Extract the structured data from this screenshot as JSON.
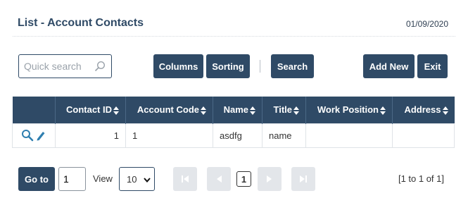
{
  "header": {
    "title": "List - Account Contacts",
    "date": "01/09/2020"
  },
  "toolbar": {
    "search_placeholder": "Quick search",
    "columns_label": "Columns",
    "sorting_label": "Sorting",
    "search_label": "Search",
    "add_new_label": "Add New",
    "exit_label": "Exit"
  },
  "table": {
    "headers": [
      "Contact ID",
      "Account Code",
      "Name",
      "Title",
      "Work Position",
      "Address"
    ],
    "rows": [
      {
        "contact_id": "1",
        "account_code": "1",
        "name": "asdfg",
        "title": "name",
        "work_position": "",
        "address": ""
      }
    ]
  },
  "pagination": {
    "goto_label": "Go to",
    "goto_value": "1",
    "view_label": "View",
    "page_size": "10",
    "current_page": "1",
    "range_text": "[1 to 1 of 1]"
  },
  "colors": {
    "primary": "#2f4a66",
    "icon": "#2f7fb0",
    "disabled": "#e3e6ea"
  },
  "icons": [
    "search-icon",
    "sort-icon",
    "view-icon",
    "edit-icon",
    "first-page-icon",
    "prev-page-icon",
    "next-page-icon",
    "last-page-icon",
    "chevron-down-icon"
  ]
}
